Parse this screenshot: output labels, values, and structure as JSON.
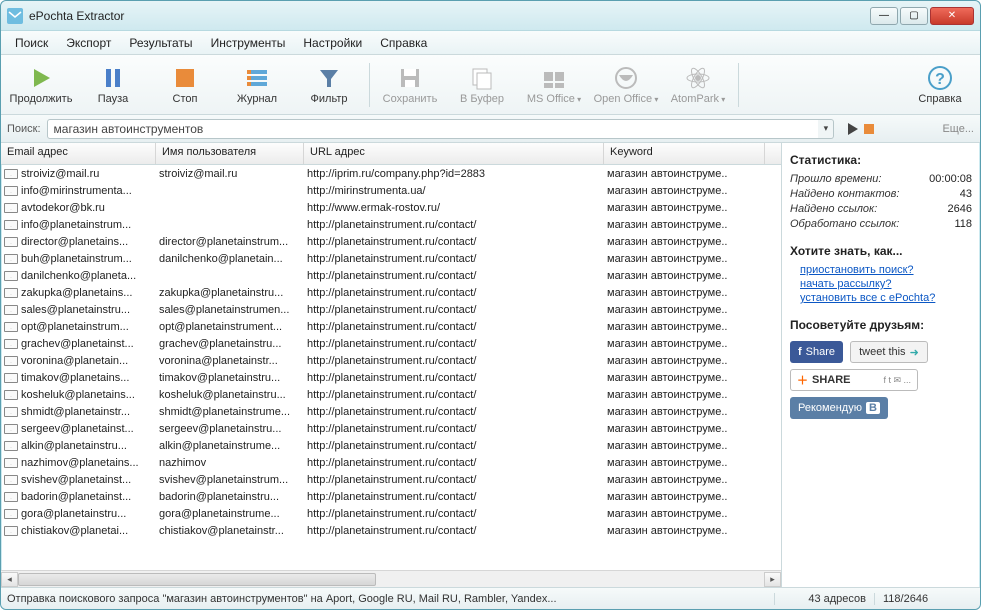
{
  "window": {
    "title": "ePochta Extractor"
  },
  "menubar": [
    "Поиск",
    "Экспорт",
    "Результаты",
    "Инструменты",
    "Настройки",
    "Справка"
  ],
  "toolbar": [
    {
      "id": "continue",
      "label": "Продолжить",
      "disabled": false
    },
    {
      "id": "pause",
      "label": "Пауза",
      "disabled": false
    },
    {
      "id": "stop",
      "label": "Стоп",
      "disabled": false
    },
    {
      "id": "journal",
      "label": "Журнал",
      "disabled": false
    },
    {
      "id": "filter",
      "label": "Фильтр",
      "disabled": false
    },
    {
      "id": "save",
      "label": "Сохранить",
      "disabled": true
    },
    {
      "id": "buffer",
      "label": "В Буфер",
      "disabled": true
    },
    {
      "id": "msoffice",
      "label": "MS Office",
      "disabled": true
    },
    {
      "id": "openoffice",
      "label": "Open Office",
      "disabled": true
    },
    {
      "id": "atompark",
      "label": "AtomPark",
      "disabled": true
    },
    {
      "id": "help",
      "label": "Справка",
      "disabled": false
    }
  ],
  "search": {
    "label": "Поиск:",
    "value": "магазин автоинструментов",
    "more": "Еще..."
  },
  "columns": {
    "email": "Email адрес",
    "user": "Имя пользователя",
    "url": "URL адрес",
    "kw": "Keyword"
  },
  "rows": [
    {
      "email": "stroiviz@mail.ru",
      "user": "stroiviz@mail.ru",
      "url": "http://iprim.ru/company.php?id=2883",
      "kw": "магазин автоинструме.."
    },
    {
      "email": "info@mirinstrumenta...",
      "user": "",
      "url": "http://mirinstrumenta.ua/",
      "kw": "магазин автоинструме.."
    },
    {
      "email": "avtodekor@bk.ru",
      "user": "",
      "url": "http://www.ermak-rostov.ru/",
      "kw": "магазин автоинструме.."
    },
    {
      "email": "info@planetainstrum...",
      "user": "",
      "url": "http://planetainstrument.ru/contact/",
      "kw": "магазин автоинструме.."
    },
    {
      "email": "director@planetains...",
      "user": "director@planetainstrum...",
      "url": "http://planetainstrument.ru/contact/",
      "kw": "магазин автоинструме.."
    },
    {
      "email": "buh@planetainstrum...",
      "user": "danilchenko@planetain...",
      "url": "http://planetainstrument.ru/contact/",
      "kw": "магазин автоинструме.."
    },
    {
      "email": "danilchenko@planeta...",
      "user": "",
      "url": "http://planetainstrument.ru/contact/",
      "kw": "магазин автоинструме.."
    },
    {
      "email": "zakupka@planetains...",
      "user": "zakupka@planetainstru...",
      "url": "http://planetainstrument.ru/contact/",
      "kw": "магазин автоинструме.."
    },
    {
      "email": "sales@planetainstru...",
      "user": "sales@planetainstrumen...",
      "url": "http://planetainstrument.ru/contact/",
      "kw": "магазин автоинструме.."
    },
    {
      "email": "opt@planetainstrum...",
      "user": "opt@planetainstrument...",
      "url": "http://planetainstrument.ru/contact/",
      "kw": "магазин автоинструме.."
    },
    {
      "email": "grachev@planetainst...",
      "user": "grachev@planetainstru...",
      "url": "http://planetainstrument.ru/contact/",
      "kw": "магазин автоинструме.."
    },
    {
      "email": "voronina@planetain...",
      "user": "voronina@planetainstr...",
      "url": "http://planetainstrument.ru/contact/",
      "kw": "магазин автоинструме.."
    },
    {
      "email": "timakov@planetains...",
      "user": "timakov@planetainstru...",
      "url": "http://planetainstrument.ru/contact/",
      "kw": "магазин автоинструме.."
    },
    {
      "email": "kosheluk@planetains...",
      "user": "kosheluk@planetainstru...",
      "url": "http://planetainstrument.ru/contact/",
      "kw": "магазин автоинструме.."
    },
    {
      "email": "shmidt@planetainstr...",
      "user": "shmidt@planetainstrume...",
      "url": "http://planetainstrument.ru/contact/",
      "kw": "магазин автоинструме.."
    },
    {
      "email": "sergeev@planetainst...",
      "user": "sergeev@planetainstru...",
      "url": "http://planetainstrument.ru/contact/",
      "kw": "магазин автоинструме.."
    },
    {
      "email": "alkin@planetainstru...",
      "user": "alkin@planetainstrume...",
      "url": "http://planetainstrument.ru/contact/",
      "kw": "магазин автоинструме.."
    },
    {
      "email": "nazhimov@planetains...",
      "user": "nazhimov",
      "url": "http://planetainstrument.ru/contact/",
      "kw": "магазин автоинструме.."
    },
    {
      "email": "svishev@planetainst...",
      "user": "svishev@planetainstrum...",
      "url": "http://planetainstrument.ru/contact/",
      "kw": "магазин автоинструме.."
    },
    {
      "email": "badorin@planetainst...",
      "user": "badorin@planetainstru...",
      "url": "http://planetainstrument.ru/contact/",
      "kw": "магазин автоинструме.."
    },
    {
      "email": "gora@planetainstru...",
      "user": "gora@planetainstrume...",
      "url": "http://planetainstrument.ru/contact/",
      "kw": "магазин автоинструме.."
    },
    {
      "email": "chistiakov@planetai...",
      "user": "chistiakov@planetainstr...",
      "url": "http://planetainstrument.ru/contact/",
      "kw": "магазин автоинструме.."
    }
  ],
  "sidebar": {
    "stats_heading": "Статистика:",
    "elapsed_label": "Прошло времени:",
    "elapsed_value": "00:00:08",
    "contacts_label": "Найдено контактов:",
    "contacts_value": "43",
    "links_label": "Найдено ссылок:",
    "links_value": "2646",
    "processed_label": "Обработано ссылок:",
    "processed_value": "118",
    "howto_heading": "Хотите знать, как...",
    "howto_links": [
      "приостановить поиск?",
      "начать рассылку?",
      "установить все с ePochta?"
    ],
    "share_heading": "Посоветуйте друзьям:",
    "fb": "Share",
    "tw": "tweet this",
    "add": "SHARE",
    "vk": "Рекомендую"
  },
  "status": {
    "main": "Отправка поискового запроса \"магазин автоинструментов\" на Aport, Google RU, Mail RU, Rambler, Yandex...",
    "addresses": "43 адресов",
    "progress": "118/2646"
  }
}
